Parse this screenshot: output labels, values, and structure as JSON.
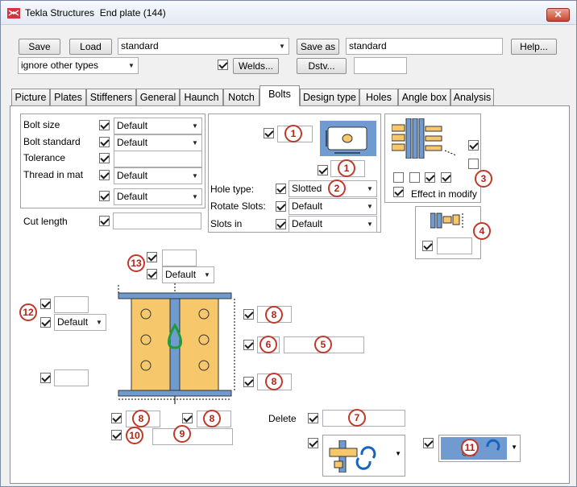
{
  "window": {
    "title": "Tekla Structures  End plate (144)",
    "close_glyph": "✕"
  },
  "toolbar": {
    "save_label": "Save",
    "load_label": "Load",
    "preset_value": "standard",
    "saveas_label": "Save as",
    "saveas_value": "standard",
    "help_label": "Help...",
    "ignore_value": "ignore other types",
    "welds_label": "Welds...",
    "dstv_label": "Dstv...",
    "dstv_value": ""
  },
  "tabs": [
    "Picture",
    "Plates",
    "Stiffeners",
    "General",
    "Haunch",
    "Notch",
    "Bolts",
    "Design type",
    "Holes",
    "Angle box",
    "Analysis"
  ],
  "active_tab": "Bolts",
  "bolt_props": {
    "bolt_size_label": "Bolt size",
    "bolt_size_value": "Default",
    "bolt_standard_label": "Bolt standard",
    "bolt_standard_value": "Default",
    "tolerance_label": "Tolerance",
    "tolerance_value": "",
    "thread_label": "Thread in mat",
    "thread_value": "Default",
    "extra_value": "Default"
  },
  "cut_length": {
    "label": "Cut length",
    "value": ""
  },
  "hole": {
    "hole_type_label": "Hole type:",
    "hole_type_value": "Slotted",
    "rotate_label": "Rotate Slots:",
    "rotate_value": "Default",
    "slots_in_label": "Slots in",
    "slots_in_value": "Default"
  },
  "effect": {
    "label": "Effect in modify"
  },
  "layout": {
    "value_13": "Default",
    "value_12": "Default",
    "delete_label": "Delete"
  },
  "markers": [
    "1",
    "1",
    "2",
    "3",
    "4",
    "13",
    "12",
    "8",
    "6",
    "5",
    "8",
    "8",
    "8",
    "7",
    "10",
    "9",
    "11"
  ],
  "colors": {
    "accent_red": "#c0392b",
    "plate_orange": "#f6c76b",
    "steel_blue": "#6f9bd1"
  }
}
